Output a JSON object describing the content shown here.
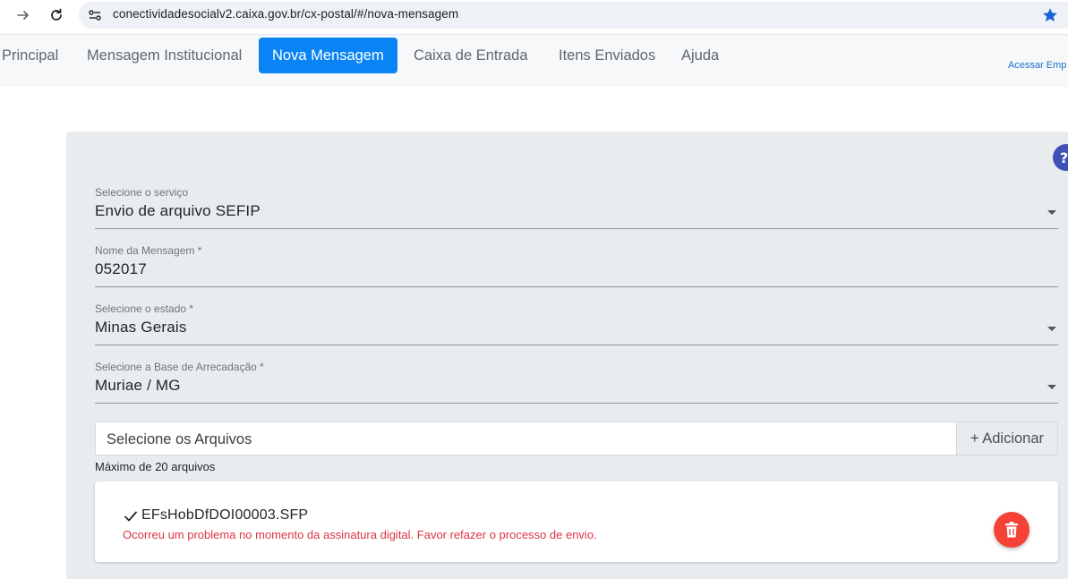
{
  "browser": {
    "url": "conectividadesocialv2.caixa.gov.br/cx-postal/#/nova-mensagem"
  },
  "nav": {
    "items": [
      {
        "label": "Principal"
      },
      {
        "label": "Mensagem Institucional"
      },
      {
        "label": "Nova Mensagem",
        "active": true
      },
      {
        "label": "Caixa de Entrada"
      },
      {
        "label": "Itens Enviados"
      },
      {
        "label": "Ajuda"
      }
    ],
    "acessar_label": "Acessar Emp"
  },
  "form": {
    "service": {
      "label": "Selecione o serviço",
      "value": "Envio de arquivo SEFIP"
    },
    "message_name": {
      "label": "Nome da Mensagem *",
      "value": "052017"
    },
    "state": {
      "label": "Selecione o estado *",
      "value": "Minas Gerais"
    },
    "base": {
      "label": "Selecione a Base de Arrecadação *",
      "value": "Muriae / MG"
    },
    "files": {
      "placeholder": "Selecione os Arquivos",
      "add_label": "+ Adicionar",
      "max_note": "Máximo de 20 arquivos",
      "items": [
        {
          "name": "EFsHobDfDOI00003.SFP",
          "error": "Ocorreu um problema no momento da assinatura digital. Favor refazer o processo de envio."
        }
      ]
    }
  },
  "colors": {
    "accent": "#0a83f4",
    "error": "#dc3545",
    "delete": "#f44336",
    "panel": "#e9ecef"
  },
  "icons": {
    "back": "arrow-right-icon",
    "reload": "reload-icon",
    "site": "site-settings-icon",
    "bookmark": "star-icon",
    "help": "help-icon",
    "check": "check-icon",
    "delete": "trash-icon"
  }
}
